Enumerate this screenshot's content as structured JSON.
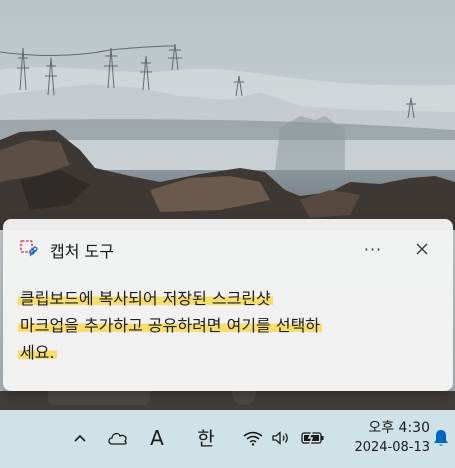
{
  "toast": {
    "app_name": "캡처 도구",
    "app_icon": "snipping-tool-icon",
    "more_label": "···",
    "close_icon": "close-icon",
    "line1": "클립보드에 복사되어 저장된 스크린샷",
    "line2": "마크업을 추가하고 공유하려면 여기를 선택하",
    "line3": "세요."
  },
  "taskbar": {
    "chevron_icon": "chevron-up-icon",
    "weather_icon": "cloud-icon",
    "ime_english": "A",
    "ime_korean": "한",
    "wifi_icon": "wifi-icon",
    "volume_icon": "volume-icon",
    "battery_icon": "battery-charging-icon",
    "time": "오후 4:30",
    "date": "2024-08-13",
    "notification_icon": "bell-icon"
  },
  "colors": {
    "highlight": "#f8db5c",
    "toast_bg": "#f3f3f3",
    "taskbar_bg": "#cfe2e7",
    "bell_accent": "#0067c0"
  }
}
